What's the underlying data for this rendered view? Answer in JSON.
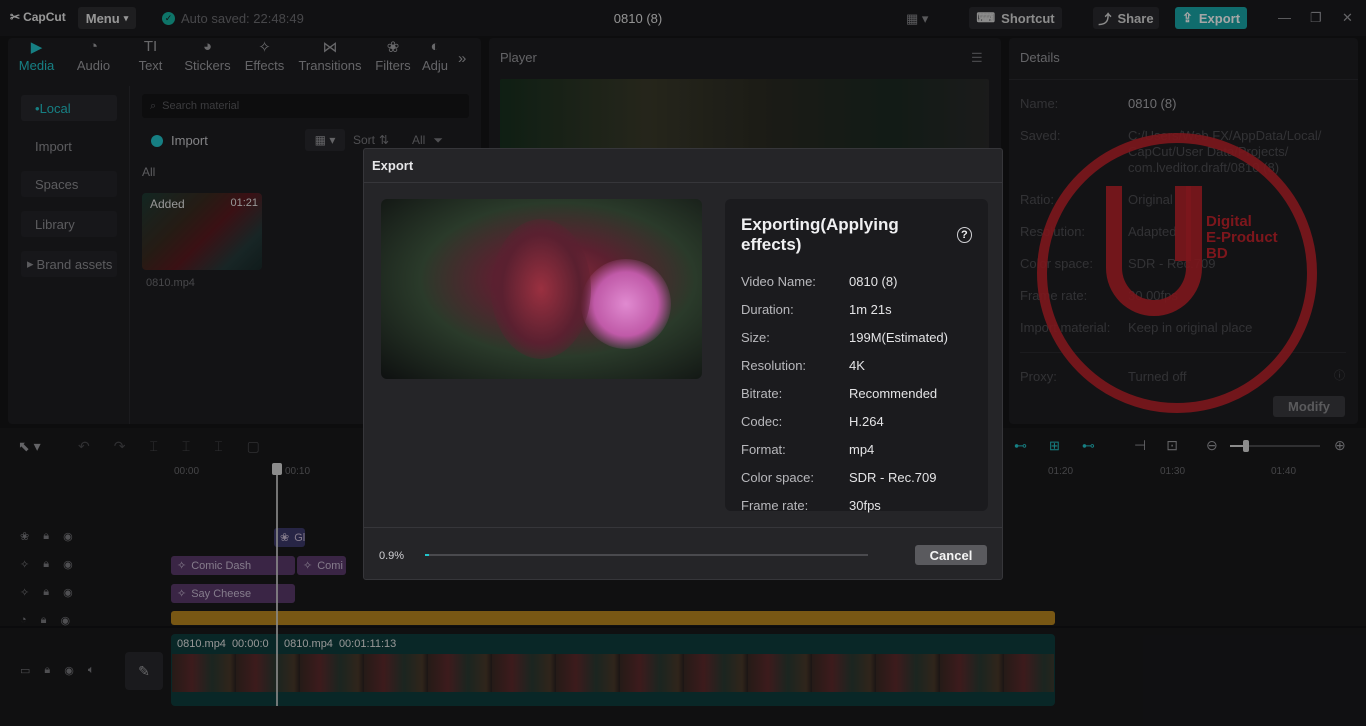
{
  "app": {
    "logo": "CapCut",
    "menu_label": "Menu",
    "autosave": "Auto saved: 22:48:49",
    "title": "0810 (8)"
  },
  "topbar": {
    "shortcut": "Shortcut",
    "share": "Share",
    "export": "Export"
  },
  "tabs": [
    {
      "label": "Media",
      "icon": "media-icon"
    },
    {
      "label": "Audio",
      "icon": "audio-icon"
    },
    {
      "label": "Text",
      "icon": "text-icon"
    },
    {
      "label": "Stickers",
      "icon": "stickers-icon"
    },
    {
      "label": "Effects",
      "icon": "effects-icon"
    },
    {
      "label": "Transitions",
      "icon": "transitions-icon"
    },
    {
      "label": "Filters",
      "icon": "filters-icon"
    },
    {
      "label": "Adju",
      "icon": "adjust-icon"
    }
  ],
  "sidebar": [
    "Local",
    "Import",
    "Spaces",
    "Library",
    "Brand assets"
  ],
  "media": {
    "search_placeholder": "Search material",
    "import": "Import",
    "sort": "Sort",
    "all_filter": "All",
    "section": "All",
    "clip_badge": "Added",
    "clip_duration": "01:21",
    "clip_name": "0810.mp4"
  },
  "player": {
    "label": "Player"
  },
  "details": {
    "header": "Details",
    "rows": [
      {
        "k": "Name:",
        "v": "0810 (8)"
      },
      {
        "k": "Saved:",
        "v": "C:/Users/Web FX/AppData/Local/ CapCut/User Data/Projects/ com.lveditor.draft/0810 (8)"
      },
      {
        "k": "Ratio:",
        "v": "Original"
      },
      {
        "k": "Resolution:",
        "v": "Adapted"
      },
      {
        "k": "Color space:",
        "v": "SDR - Rec.709"
      },
      {
        "k": "Frame rate:",
        "v": "30.00fps"
      },
      {
        "k": "Import material:",
        "v": "Keep in original place"
      },
      {
        "k": "Proxy:",
        "v": "Turned off"
      }
    ],
    "modify": "Modify"
  },
  "watermark": {
    "line1": "Digital",
    "line2": "E-Product",
    "line3": "BD"
  },
  "export_modal": {
    "title": "Export",
    "status": "Exporting(Applying effects)",
    "rows": [
      {
        "k": "Video Name:",
        "v": "0810 (8)"
      },
      {
        "k": "Duration:",
        "v": "1m 21s"
      },
      {
        "k": "Size:",
        "v": "199M(Estimated)"
      },
      {
        "k": "Resolution:",
        "v": "4K"
      },
      {
        "k": "Bitrate:",
        "v": "Recommended"
      },
      {
        "k": "Codec:",
        "v": "H.264"
      },
      {
        "k": "Format:",
        "v": "mp4"
      },
      {
        "k": "Color space:",
        "v": "SDR - Rec.709"
      },
      {
        "k": "Frame rate:",
        "v": "30fps"
      }
    ],
    "progress_label": "0.9%",
    "progress": 0.009,
    "cancel": "Cancel"
  },
  "timeline": {
    "ruler": [
      "00:00",
      "00:10",
      "01:20",
      "01:30",
      "01:40"
    ],
    "clips": {
      "effect_g": "Gl",
      "comic_dash": "Comic Dash",
      "comic2": "Comi",
      "say_cheese": "Say Cheese",
      "video1": "0810.mp4",
      "video1_time": "00:00:0",
      "video2": "0810.mp4",
      "video2_time": "00:01:11:13"
    }
  }
}
